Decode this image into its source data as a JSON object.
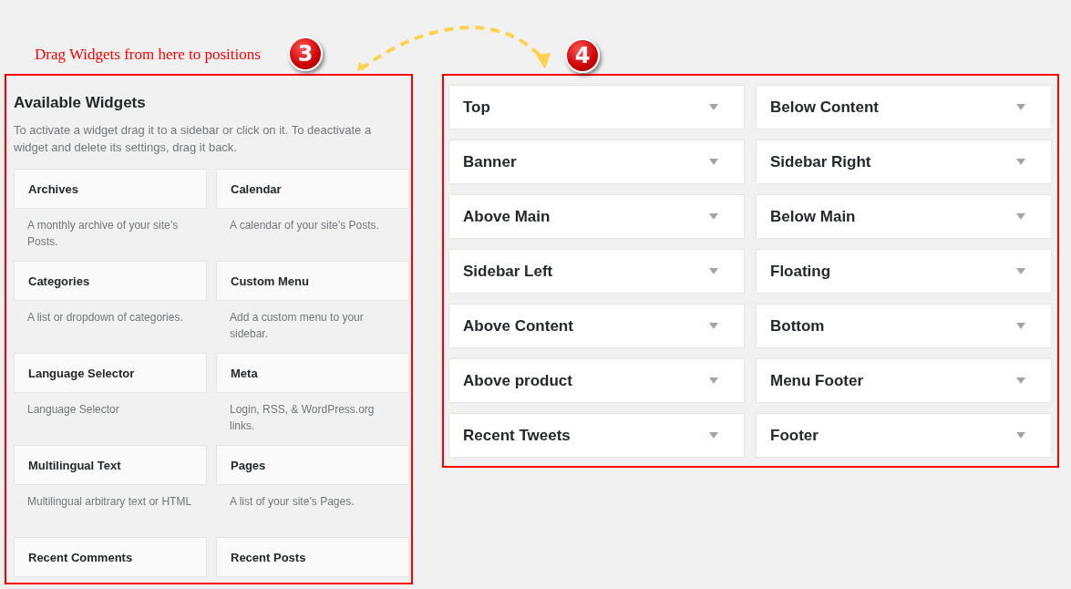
{
  "annotation": {
    "text": "Drag Widgets from here to positions",
    "badges": [
      "3",
      "4"
    ]
  },
  "available_widgets": {
    "title": "Available Widgets",
    "description": "To activate a widget drag it to a sidebar or click on it. To deactivate a widget and delete its settings, drag it back.",
    "widgets": [
      {
        "name": "Archives",
        "description": "A monthly archive of your site’s Posts."
      },
      {
        "name": "Calendar",
        "description": "A calendar of your site’s Posts."
      },
      {
        "name": "Categories",
        "description": "A list or dropdown of categories."
      },
      {
        "name": "Custom Menu",
        "description": "Add a custom menu to your sidebar."
      },
      {
        "name": "Language Selector",
        "description": "Language Selector"
      },
      {
        "name": "Meta",
        "description": "Login, RSS, & WordPress.org links."
      },
      {
        "name": "Multilingual Text",
        "description": "Multilingual arbitrary text or HTML"
      },
      {
        "name": "Pages",
        "description": "A list of your site’s Pages."
      },
      {
        "name": "Recent Comments"
      },
      {
        "name": "Recent Posts"
      }
    ]
  },
  "positions": [
    {
      "name": "Top"
    },
    {
      "name": "Below Content"
    },
    {
      "name": "Banner"
    },
    {
      "name": "Sidebar Right"
    },
    {
      "name": "Above Main"
    },
    {
      "name": "Below Main"
    },
    {
      "name": "Sidebar Left"
    },
    {
      "name": "Floating"
    },
    {
      "name": "Above Content"
    },
    {
      "name": "Bottom"
    },
    {
      "name": "Above product"
    },
    {
      "name": "Menu Footer"
    },
    {
      "name": "Recent Tweets"
    },
    {
      "name": "Footer"
    }
  ]
}
